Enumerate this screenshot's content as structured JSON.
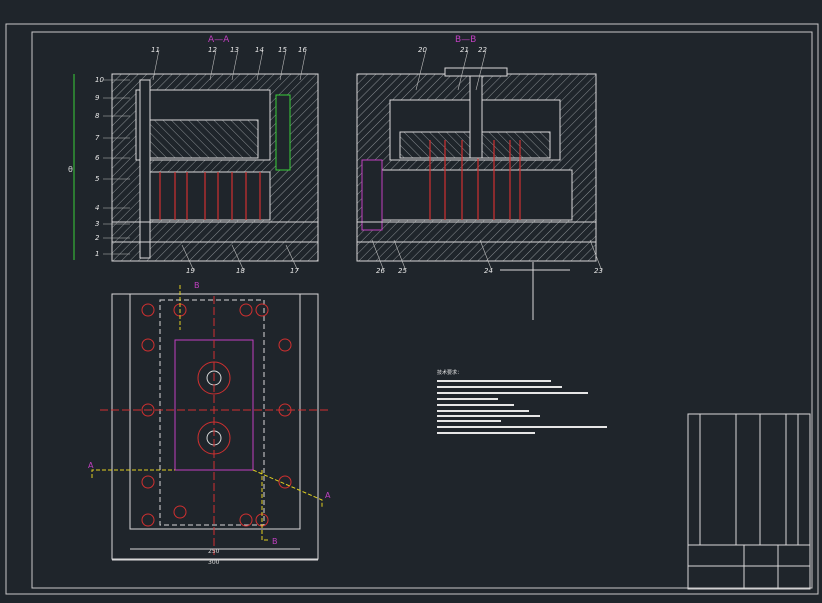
{
  "drawing": {
    "section_aa_title": "A—A",
    "section_bb_title": "B—B",
    "plan_label_a": "A",
    "plan_label_b": "B"
  },
  "callouts_aa_left": [
    "10",
    "9",
    "8",
    "7",
    "6",
    "5",
    "4",
    "3",
    "2",
    "1"
  ],
  "callouts_aa_top": [
    "11",
    "12",
    "13",
    "14",
    "15",
    "16"
  ],
  "callouts_aa_bottom": [
    "19",
    "18",
    "17"
  ],
  "callouts_bb_top": [
    "20",
    "21",
    "22"
  ],
  "callouts_bb_bottom": [
    "26",
    "25",
    "24",
    "23"
  ],
  "dims": {
    "height": "θ",
    "plan_width_inner": "250",
    "plan_width_outer": "300"
  },
  "notes_title": "技术要求："
}
